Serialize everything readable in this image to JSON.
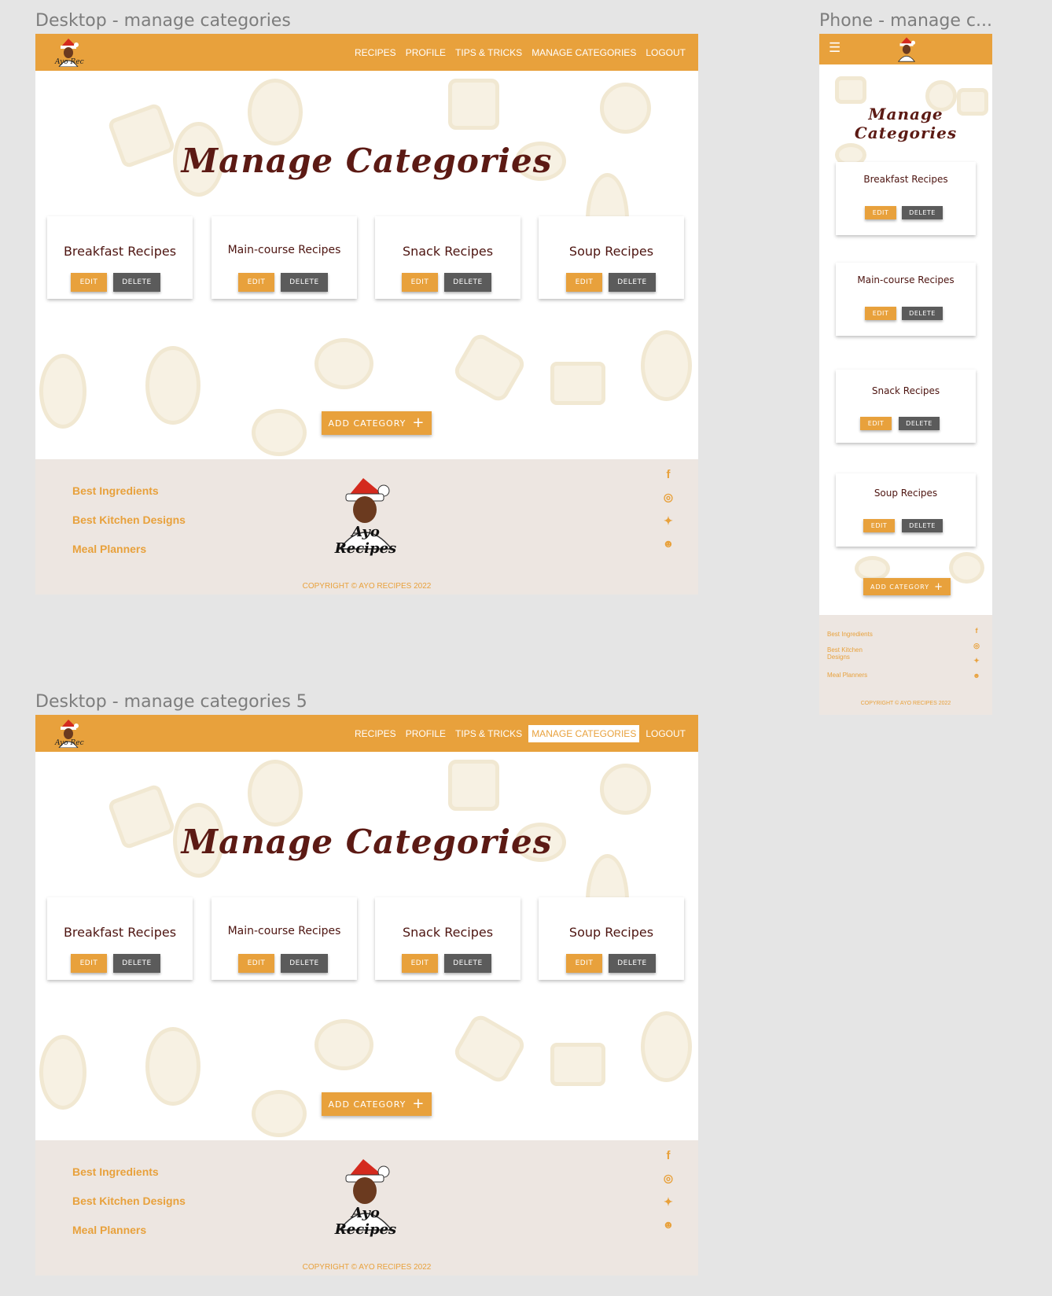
{
  "frames": {
    "desktop1_title": "Desktop - manage categories",
    "desktop2_title": "Desktop - manage categories 5",
    "phone_title": "Phone - manage c..."
  },
  "nav": {
    "links": [
      "RECIPES",
      "PROFILE",
      "TIPS & TRICKS",
      "MANAGE CATEGORIES",
      "LOGOUT"
    ]
  },
  "hero_title": "Manage Categories",
  "categories": [
    "Breakfast Recipes",
    "Main-course Recipes",
    "Snack Recipes",
    "Soup Recipes"
  ],
  "buttons": {
    "edit": "EDIT",
    "delete": "DELETE",
    "add_category": "ADD CATEGORY"
  },
  "footer": {
    "links": [
      "Best Ingredients",
      "Best Kitchen Designs",
      "Meal Planners"
    ],
    "logo_text": "Ayo Recipes",
    "copyright": "COPYRIGHT © AYO RECIPES 2022"
  },
  "icons": [
    "facebook-icon",
    "instagram-icon",
    "twitter-icon",
    "github-icon",
    "hamburger-menu-icon",
    "plus-icon"
  ],
  "colors": {
    "accent": "#e8a13c",
    "title": "#5c1a14",
    "delete": "#5b5b5b",
    "footer_bg": "#ede6e1"
  }
}
